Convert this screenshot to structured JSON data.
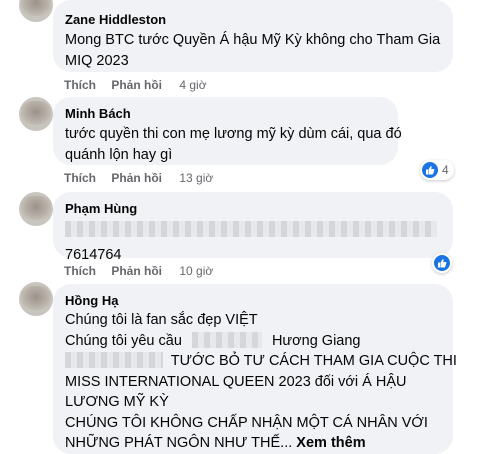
{
  "actions": {
    "like": "Thích",
    "reply": "Phản hồi"
  },
  "comments": [
    {
      "author": "Zane Hiddleston",
      "lines": [
        "Mong BTC tước Quyền Á hậu Mỹ Kỳ không cho Tham Gia",
        "MIQ 2023"
      ],
      "time": "4 giờ"
    },
    {
      "author": "Minh Bách",
      "lines": [
        "tước quyền thi con mẹ lương mỹ kỳ dùm cái, qua đó",
        "quánh lộn hay gì"
      ],
      "time": "13 giờ",
      "reaction_count": "4"
    },
    {
      "author": "Phạm Hùng",
      "lines": [
        "7614764"
      ],
      "time": "10 giờ",
      "reaction_count": ""
    },
    {
      "author": "Hồng Hạ",
      "lines": [
        "Chúng tôi là fan sắc đẹp VIỆT",
        "Chúng tôi yêu cầu",
        "Hương Giang",
        "TƯỚC BỎ TƯ CÁCH THAM GIA CUỘC THI",
        "MISS INTERNATIONAL QUEEN 2023 đối với Á HẬU",
        "LƯƠNG MỸ KỲ",
        "CHÚNG TÔI KHÔNG CHẤP NHẬN MỘT CÁ NHÂN VỚI",
        "NHỮNG PHÁT NGÔN NHƯ THẾ..."
      ],
      "see_more": "Xem thêm"
    }
  ],
  "colors": {
    "bubble": "#f0f2f5",
    "text": "#050505",
    "meta": "#65676b",
    "like_blue": "#1b74e4"
  }
}
